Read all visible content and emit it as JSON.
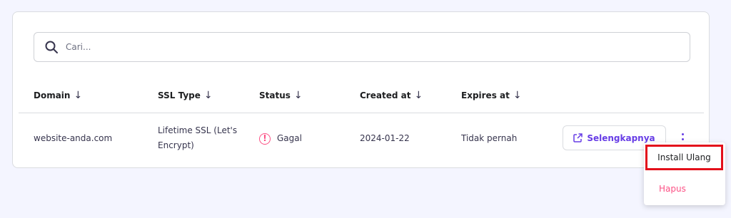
{
  "search": {
    "placeholder": "Cari..."
  },
  "table": {
    "columns": [
      {
        "label": "Domain",
        "sort_icon": "arrow-down-icon"
      },
      {
        "label": "SSL Type",
        "sort_icon": "arrow-down-icon"
      },
      {
        "label": "Status",
        "sort_icon": "arrow-down-icon"
      },
      {
        "label": "Created at",
        "sort_icon": "arrow-down-icon"
      },
      {
        "label": "Expires at",
        "sort_icon": "arrow-down-icon"
      }
    ],
    "rows": [
      {
        "domain": "website-anda.com",
        "ssl_type_line1": "Lifetime SSL (Let's",
        "ssl_type_line2": "Encrypt)",
        "status": "Gagal",
        "created_at": "2024-01-22",
        "expires_at": "Tidak pernah",
        "action_label": "Selengkapnya"
      }
    ]
  },
  "context_menu": {
    "items": [
      {
        "label": "Install Ulang"
      },
      {
        "label": "Hapus"
      }
    ]
  },
  "colors": {
    "accent": "#673de6",
    "danger": "#fc5185",
    "highlight": "#e3101b",
    "background": "#f4f5ff"
  }
}
